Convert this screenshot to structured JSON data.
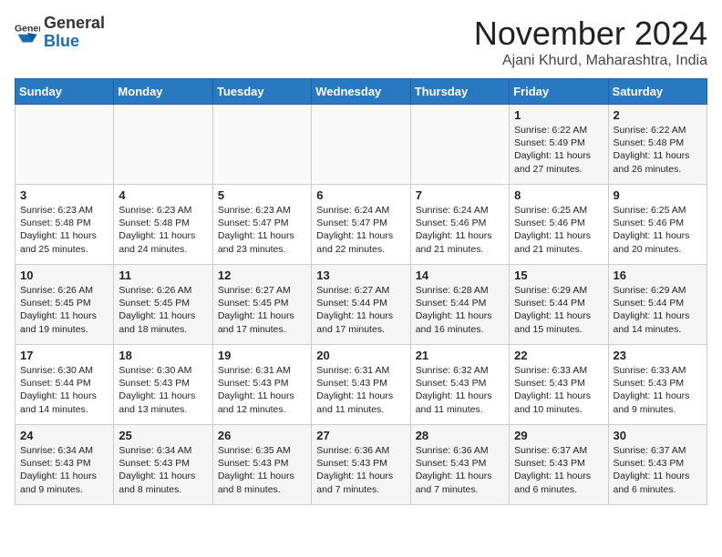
{
  "header": {
    "logo_general": "General",
    "logo_blue": "Blue",
    "month_title": "November 2024",
    "location": "Ajani Khurd, Maharashtra, India"
  },
  "weekdays": [
    "Sunday",
    "Monday",
    "Tuesday",
    "Wednesday",
    "Thursday",
    "Friday",
    "Saturday"
  ],
  "weeks": [
    [
      {
        "day": "",
        "info": ""
      },
      {
        "day": "",
        "info": ""
      },
      {
        "day": "",
        "info": ""
      },
      {
        "day": "",
        "info": ""
      },
      {
        "day": "",
        "info": ""
      },
      {
        "day": "1",
        "info": "Sunrise: 6:22 AM\nSunset: 5:49 PM\nDaylight: 11 hours and 27 minutes."
      },
      {
        "day": "2",
        "info": "Sunrise: 6:22 AM\nSunset: 5:48 PM\nDaylight: 11 hours and 26 minutes."
      }
    ],
    [
      {
        "day": "3",
        "info": "Sunrise: 6:23 AM\nSunset: 5:48 PM\nDaylight: 11 hours and 25 minutes."
      },
      {
        "day": "4",
        "info": "Sunrise: 6:23 AM\nSunset: 5:48 PM\nDaylight: 11 hours and 24 minutes."
      },
      {
        "day": "5",
        "info": "Sunrise: 6:23 AM\nSunset: 5:47 PM\nDaylight: 11 hours and 23 minutes."
      },
      {
        "day": "6",
        "info": "Sunrise: 6:24 AM\nSunset: 5:47 PM\nDaylight: 11 hours and 22 minutes."
      },
      {
        "day": "7",
        "info": "Sunrise: 6:24 AM\nSunset: 5:46 PM\nDaylight: 11 hours and 21 minutes."
      },
      {
        "day": "8",
        "info": "Sunrise: 6:25 AM\nSunset: 5:46 PM\nDaylight: 11 hours and 21 minutes."
      },
      {
        "day": "9",
        "info": "Sunrise: 6:25 AM\nSunset: 5:46 PM\nDaylight: 11 hours and 20 minutes."
      }
    ],
    [
      {
        "day": "10",
        "info": "Sunrise: 6:26 AM\nSunset: 5:45 PM\nDaylight: 11 hours and 19 minutes."
      },
      {
        "day": "11",
        "info": "Sunrise: 6:26 AM\nSunset: 5:45 PM\nDaylight: 11 hours and 18 minutes."
      },
      {
        "day": "12",
        "info": "Sunrise: 6:27 AM\nSunset: 5:45 PM\nDaylight: 11 hours and 17 minutes."
      },
      {
        "day": "13",
        "info": "Sunrise: 6:27 AM\nSunset: 5:44 PM\nDaylight: 11 hours and 17 minutes."
      },
      {
        "day": "14",
        "info": "Sunrise: 6:28 AM\nSunset: 5:44 PM\nDaylight: 11 hours and 16 minutes."
      },
      {
        "day": "15",
        "info": "Sunrise: 6:29 AM\nSunset: 5:44 PM\nDaylight: 11 hours and 15 minutes."
      },
      {
        "day": "16",
        "info": "Sunrise: 6:29 AM\nSunset: 5:44 PM\nDaylight: 11 hours and 14 minutes."
      }
    ],
    [
      {
        "day": "17",
        "info": "Sunrise: 6:30 AM\nSunset: 5:44 PM\nDaylight: 11 hours and 14 minutes."
      },
      {
        "day": "18",
        "info": "Sunrise: 6:30 AM\nSunset: 5:43 PM\nDaylight: 11 hours and 13 minutes."
      },
      {
        "day": "19",
        "info": "Sunrise: 6:31 AM\nSunset: 5:43 PM\nDaylight: 11 hours and 12 minutes."
      },
      {
        "day": "20",
        "info": "Sunrise: 6:31 AM\nSunset: 5:43 PM\nDaylight: 11 hours and 11 minutes."
      },
      {
        "day": "21",
        "info": "Sunrise: 6:32 AM\nSunset: 5:43 PM\nDaylight: 11 hours and 11 minutes."
      },
      {
        "day": "22",
        "info": "Sunrise: 6:33 AM\nSunset: 5:43 PM\nDaylight: 11 hours and 10 minutes."
      },
      {
        "day": "23",
        "info": "Sunrise: 6:33 AM\nSunset: 5:43 PM\nDaylight: 11 hours and 9 minutes."
      }
    ],
    [
      {
        "day": "24",
        "info": "Sunrise: 6:34 AM\nSunset: 5:43 PM\nDaylight: 11 hours and 9 minutes."
      },
      {
        "day": "25",
        "info": "Sunrise: 6:34 AM\nSunset: 5:43 PM\nDaylight: 11 hours and 8 minutes."
      },
      {
        "day": "26",
        "info": "Sunrise: 6:35 AM\nSunset: 5:43 PM\nDaylight: 11 hours and 8 minutes."
      },
      {
        "day": "27",
        "info": "Sunrise: 6:36 AM\nSunset: 5:43 PM\nDaylight: 11 hours and 7 minutes."
      },
      {
        "day": "28",
        "info": "Sunrise: 6:36 AM\nSunset: 5:43 PM\nDaylight: 11 hours and 7 minutes."
      },
      {
        "day": "29",
        "info": "Sunrise: 6:37 AM\nSunset: 5:43 PM\nDaylight: 11 hours and 6 minutes."
      },
      {
        "day": "30",
        "info": "Sunrise: 6:37 AM\nSunset: 5:43 PM\nDaylight: 11 hours and 6 minutes."
      }
    ]
  ]
}
